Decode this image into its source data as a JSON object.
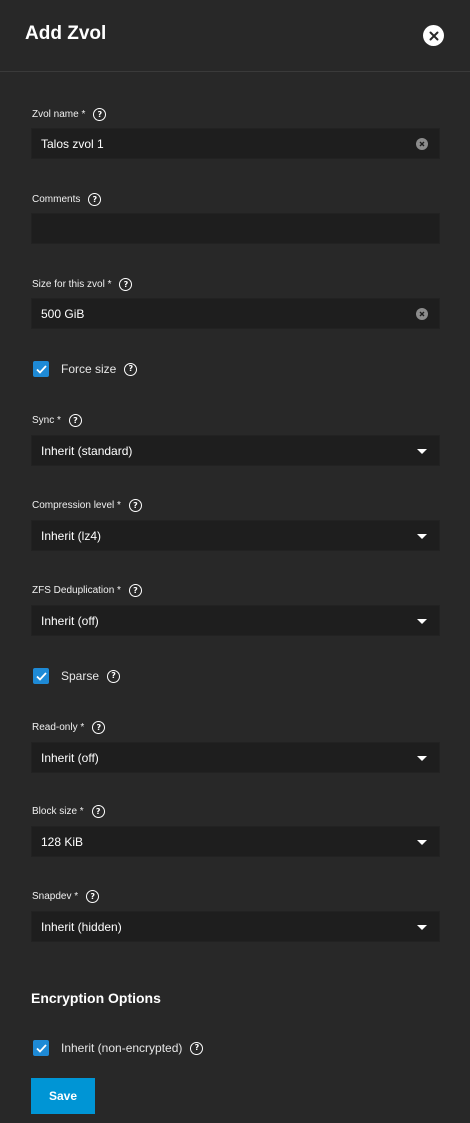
{
  "header": {
    "title": "Add Zvol"
  },
  "fields": {
    "zvol_name": {
      "label": "Zvol name *",
      "value": "Talos zvol 1"
    },
    "comments": {
      "label": "Comments",
      "value": ""
    },
    "size": {
      "label": "Size for this zvol *",
      "value": "500 GiB"
    },
    "force_size": {
      "label": "Force size",
      "checked": true
    },
    "sync": {
      "label": "Sync *",
      "value": "Inherit (standard)"
    },
    "compression": {
      "label": "Compression level *",
      "value": "Inherit (lz4)"
    },
    "dedup": {
      "label": "ZFS Deduplication *",
      "value": "Inherit (off)"
    },
    "sparse": {
      "label": "Sparse",
      "checked": true
    },
    "readonly": {
      "label": "Read-only *",
      "value": "Inherit (off)"
    },
    "blocksize": {
      "label": "Block size *",
      "value": "128 KiB"
    },
    "snapdev": {
      "label": "Snapdev *",
      "value": "Inherit (hidden)"
    }
  },
  "encryption": {
    "title": "Encryption Options",
    "inherit": {
      "label": "Inherit (non-encrypted)",
      "checked": true
    }
  },
  "actions": {
    "save_label": "Save"
  },
  "icons": {
    "help": "help-circle-icon",
    "close": "close-icon",
    "clear": "clear-icon",
    "dropdown": "chevron-down-icon"
  },
  "colors": {
    "background": "#282828",
    "input_bg": "#1e1e1e",
    "accent": "#1e8ad6",
    "save": "#0095d5"
  }
}
